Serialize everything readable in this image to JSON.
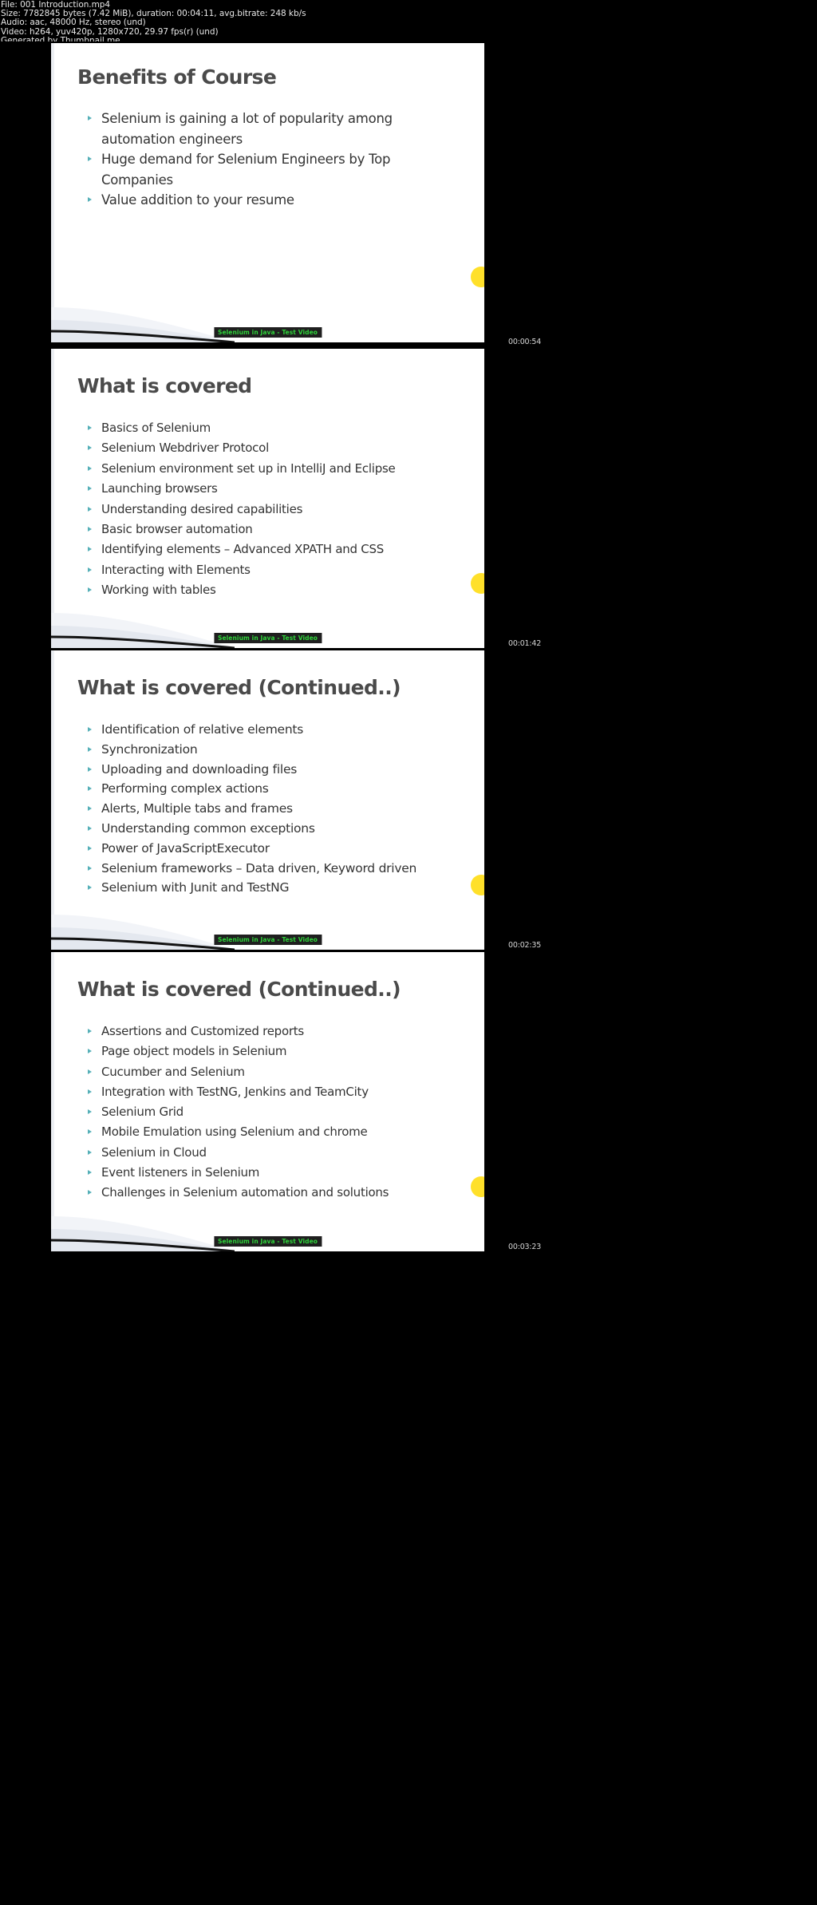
{
  "meta": {
    "lines": [
      "File: 001 Introduction.mp4",
      "Size: 7782845 bytes (7.42 MiB), duration: 00:04:11, avg.bitrate: 248 kb/s",
      "Audio: aac, 48000 Hz, stereo (und)",
      "Video: h264, yuv420p, 1280x720, 29.97 fps(r) (und)",
      "Generated by Thumbnail me"
    ]
  },
  "colors": {
    "background": "#000000",
    "slide_bg": "#ffffff",
    "title_text": "#4a4a4a",
    "body_text": "#333333",
    "bullet_marker": "#55b0b8",
    "accent_dot": "#ffe02a",
    "watermark_text": "#2fd23a",
    "watermark_bg": "#1f1f1f",
    "meta_text": "#e8e8e8"
  },
  "watermark_label": "Selenium in Java - Test Video",
  "thumbnails": [
    {
      "timecode": "00:00:54",
      "title": "Benefits of Course",
      "bullets": [
        "Selenium is gaining a lot of popularity among automation engineers",
        "Huge demand for Selenium Engineers by Top Companies",
        "Value addition to your resume"
      ]
    },
    {
      "timecode": "00:01:42",
      "title": "What is covered",
      "bullets": [
        "Basics of Selenium",
        "Selenium Webdriver Protocol",
        "Selenium environment set up in IntelliJ and Eclipse",
        "Launching browsers",
        "Understanding desired capabilities",
        "Basic browser automation",
        "Identifying elements – Advanced XPATH and CSS",
        "Interacting with Elements",
        "Working with tables"
      ]
    },
    {
      "timecode": "00:02:35",
      "title": "What is covered (Continued..)",
      "bullets": [
        "Identification of relative elements",
        "Synchronization",
        "Uploading and downloading files",
        "Performing complex actions",
        "Alerts, Multiple tabs and frames",
        "Understanding common exceptions",
        "Power of JavaScriptExecutor",
        "Selenium frameworks – Data driven, Keyword driven",
        "Selenium with Junit and TestNG"
      ]
    },
    {
      "timecode": "00:03:23",
      "title": "What is covered (Continued..)",
      "bullets": [
        "Assertions and Customized reports",
        "Page object models in Selenium",
        "Cucumber and Selenium",
        "Integration with TestNG, Jenkins and TeamCity",
        "Selenium Grid",
        "Mobile Emulation using Selenium and chrome",
        "Selenium in Cloud",
        "Event listeners in Selenium",
        "Challenges in Selenium automation and solutions"
      ]
    }
  ]
}
